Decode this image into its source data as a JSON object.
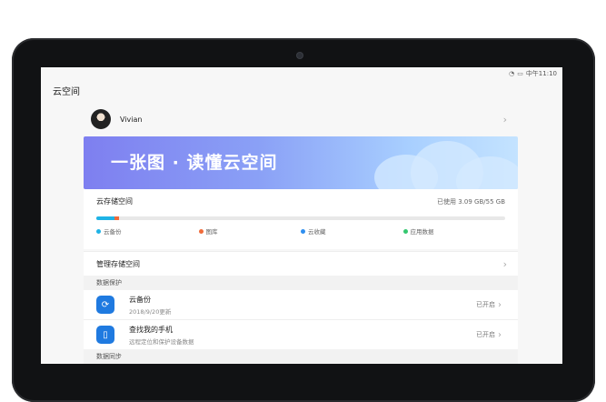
{
  "status": {
    "time": "中午11:10"
  },
  "title": "云空间",
  "profile": {
    "name": "Vivian"
  },
  "banner": {
    "text": "一张图 · 读懂云空间"
  },
  "storage": {
    "label": "云存储空间",
    "usage_text": "已使用 3.09 GB/55 GB",
    "used_fraction": 0.056,
    "legend": [
      {
        "label": "云备份",
        "color": "#1fb3e6"
      },
      {
        "label": "图库",
        "color": "#f06b3a"
      },
      {
        "label": "云收藏",
        "color": "#2e8ff0"
      },
      {
        "label": "应用数据",
        "color": "#34c76f"
      }
    ]
  },
  "manage_label": "管理存储空间",
  "sections": [
    {
      "header": "数据保护",
      "items": [
        {
          "title": "云备份",
          "subtitle": "2018/9/20更新",
          "status": "已开启",
          "icon": "cloud-backup-icon"
        },
        {
          "title": "查找我的手机",
          "subtitle": "远程定位和保护设备数据",
          "status": "已开启",
          "icon": "phone-find-icon"
        }
      ]
    },
    {
      "header": "数据同步",
      "items": []
    }
  ],
  "icons": {
    "chevron": "›",
    "backup_glyph": "⟳",
    "phone_glyph": "▯"
  }
}
